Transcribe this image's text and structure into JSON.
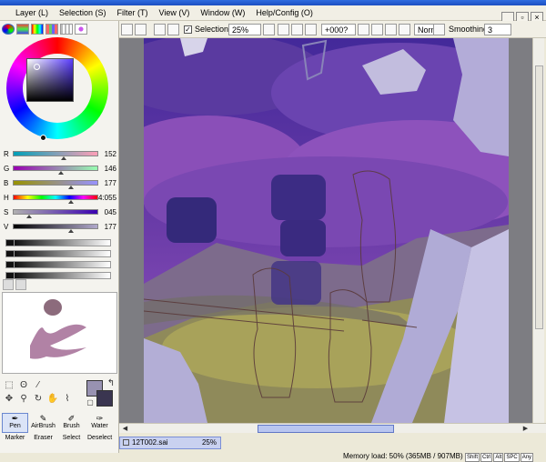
{
  "menubar": {
    "items": [
      "Layer (L)",
      "Selection (S)",
      "Filter (T)",
      "View (V)",
      "Window (W)",
      "Help/Config (O)"
    ]
  },
  "color_sliders": {
    "r": {
      "label": "R",
      "value": "152",
      "level": 0.6
    },
    "g": {
      "label": "G",
      "value": "146",
      "level": 0.57
    },
    "b": {
      "label": "B",
      "value": "177",
      "level": 0.69
    },
    "h": {
      "label": "H",
      "value": "4:055",
      "level": 0.68
    },
    "s": {
      "label": "S",
      "value": "045",
      "level": 0.18
    },
    "v": {
      "label": "V",
      "value": "177",
      "level": 0.69
    }
  },
  "colors": {
    "accent": "#3b64c8",
    "selection_bg": "#c9d1f0",
    "primary_swatch": "#9892b1",
    "secondary_swatch": "#3a3550",
    "canvas_bg": "#7d7d82"
  },
  "toolbar": {
    "selection_label": "Selection",
    "selection_checked": true,
    "zoom": "25%",
    "rotation": "+000?",
    "blend_mode": "Normal",
    "smoothing_label": "Smoothing",
    "smoothing_value": "3"
  },
  "tools": {
    "icons": [
      "rect-select-icon",
      "lasso-icon",
      "magic-wand-icon",
      "move-icon",
      "zoom-icon",
      "rotate-icon",
      "hand-icon",
      "eyedropper-icon"
    ],
    "slots": [
      {
        "label": "Pen",
        "icon": "pen-icon",
        "active": true
      },
      {
        "label": "AirBrush",
        "icon": "airbrush-icon",
        "active": false
      },
      {
        "label": "Brush",
        "icon": "brush-icon",
        "active": false
      },
      {
        "label": "Water",
        "icon": "water-icon",
        "active": false
      },
      {
        "label": "Marker",
        "icon": "marker-icon",
        "active": false
      },
      {
        "label": "Eraser",
        "icon": "eraser-icon",
        "active": false
      },
      {
        "label": "Select",
        "icon": "select-brush-icon",
        "active": false
      },
      {
        "label": "Deselect",
        "icon": "deselect-icon",
        "active": false
      }
    ]
  },
  "document": {
    "tab_name": "12T002.sai",
    "tab_zoom": "25%"
  },
  "status": {
    "memory": "Memory load: 50% (365MB / 907MB)",
    "keys": [
      "Shift",
      "Ctrl",
      "Alt",
      "SPC",
      "Any"
    ]
  }
}
